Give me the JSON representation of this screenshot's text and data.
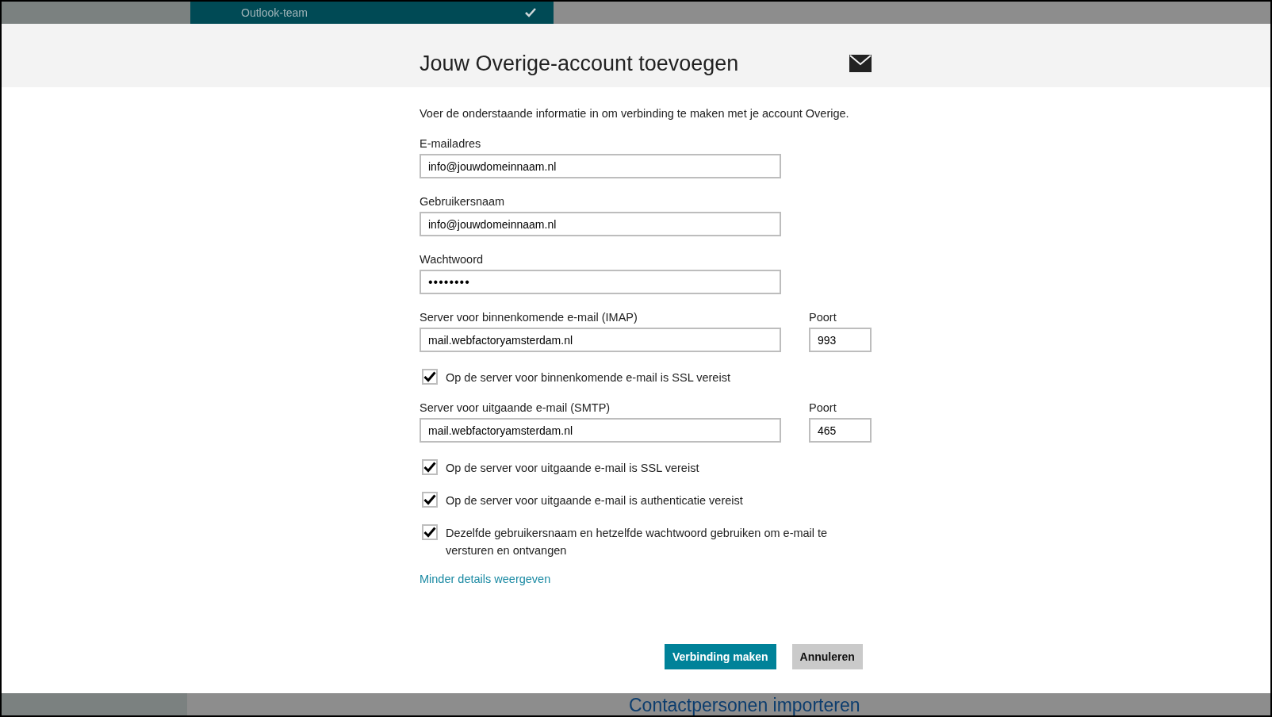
{
  "top_strip": {
    "label": "Outlook-team",
    "checked": true
  },
  "dialog": {
    "title": "Jouw Overige-account toevoegen",
    "intro": "Voer de onderstaande informatie in om verbinding te maken met je account Overige.",
    "fields": [
      {
        "kind": "text",
        "label": "E-mailadres",
        "value": "info@jouwdomeinnaam.nl"
      },
      {
        "kind": "text",
        "label": "Gebruikersnaam",
        "value": "info@jouwdomeinnaam.nl"
      },
      {
        "kind": "password",
        "label": "Wachtwoord",
        "value": "••••••••"
      }
    ],
    "incoming": {
      "label": "Server voor binnenkomende e-mail (IMAP)",
      "value": "mail.webfactoryamsterdam.nl",
      "port_label": "Poort",
      "port": "993"
    },
    "incoming_checks": [
      {
        "label": "Op de server voor binnenkomende e-mail is SSL vereist",
        "checked": true
      }
    ],
    "outgoing": {
      "label": "Server voor uitgaande e-mail (SMTP)",
      "value": "mail.webfactoryamsterdam.nl",
      "port_label": "Poort",
      "port": "465"
    },
    "outgoing_checks": [
      {
        "label": "Op de server voor uitgaande e-mail is SSL vereist",
        "checked": true
      },
      {
        "label": "Op de server voor uitgaande e-mail is authenticatie vereist",
        "checked": true
      },
      {
        "label": "Dezelfde gebruikersnaam en hetzelfde wachtwoord gebruiken om e-mail te versturen en ontvangen",
        "checked": true
      }
    ],
    "link": "Minder details weergeven",
    "buttons": [
      {
        "kind": "primary",
        "label": "Verbinding maken"
      },
      {
        "kind": "secondary",
        "label": "Annuleren"
      }
    ]
  },
  "bottom_strip": {
    "label": "Contactpersonen importeren"
  }
}
